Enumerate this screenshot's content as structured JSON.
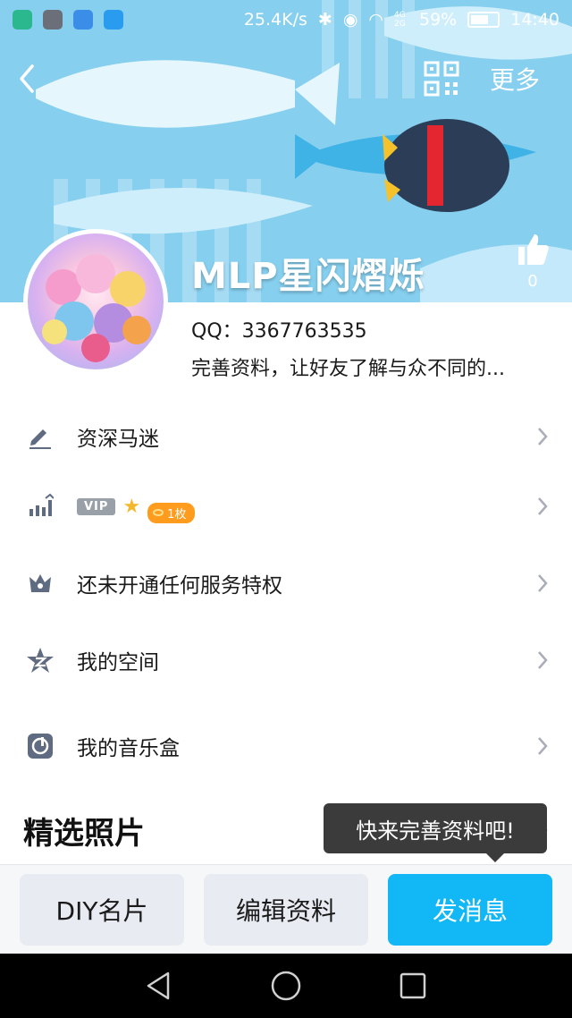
{
  "status_bar": {
    "speed": "25.4K/s",
    "network": "4G 2G",
    "battery": "59%",
    "time": "14:40"
  },
  "nav": {
    "more_label": "更多"
  },
  "profile": {
    "nickname": "MLP星闪熠烁",
    "likes": "0",
    "qq_line": "QQ：3367763535",
    "signature": "完善资料，让好友了解与众不同的..."
  },
  "rows": {
    "title_label": "资深马迷",
    "vip_tag": "VIP",
    "coin_label": "1枚",
    "service_label": "还未开通任何服务特权",
    "space_label": "我的空间",
    "music_label": "我的音乐盒"
  },
  "section": {
    "photos_title": "精选照片"
  },
  "tooltip": {
    "text": "快来完善资料吧!"
  },
  "actions": {
    "diy_card": "DIY名片",
    "edit_profile": "编辑资料",
    "send_message": "发消息"
  },
  "colors": {
    "accent": "#12b7f5",
    "banner": "#8dd3f2",
    "coin": "#ff9b1d"
  }
}
